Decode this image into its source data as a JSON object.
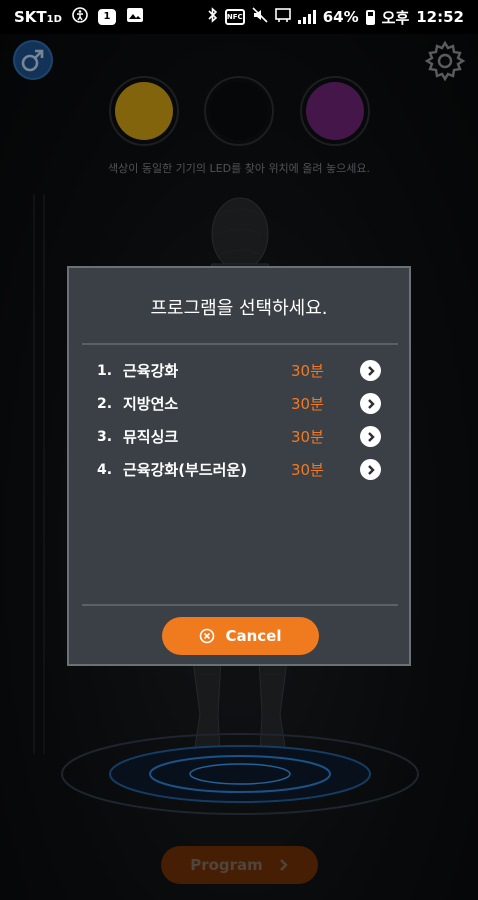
{
  "status_bar": {
    "carrier": "SKT",
    "carrier_sub": "1D",
    "notif_badge": "1",
    "nfc_label": "NFC",
    "battery": "64%",
    "ampm": "오후",
    "time": "12:52"
  },
  "header": {
    "gender_icon": "male-icon",
    "settings_icon": "gear-icon"
  },
  "leds": [
    {
      "color": "#c79a12"
    },
    {
      "color": "#0a0b0d"
    },
    {
      "color": "#6a2272"
    }
  ],
  "led_hint": "색상이 동일한 기기의 LED를 찾아 위치에 올려 놓으세요.",
  "dialog": {
    "title": "프로그램을 선택하세요.",
    "programs": [
      {
        "num": "1.",
        "name": "근육강화",
        "duration": "30분"
      },
      {
        "num": "2.",
        "name": "지방연소",
        "duration": "30분"
      },
      {
        "num": "3.",
        "name": "뮤직싱크",
        "duration": "30분"
      },
      {
        "num": "4.",
        "name": "근육강화(부드러운)",
        "duration": "30분"
      }
    ],
    "cancel_label": "Cancel"
  },
  "bottom": {
    "program_label": "Program"
  },
  "colors": {
    "accent": "#f07a1e",
    "duration": "#f07a24",
    "dialog_bg": "#3b4046"
  }
}
